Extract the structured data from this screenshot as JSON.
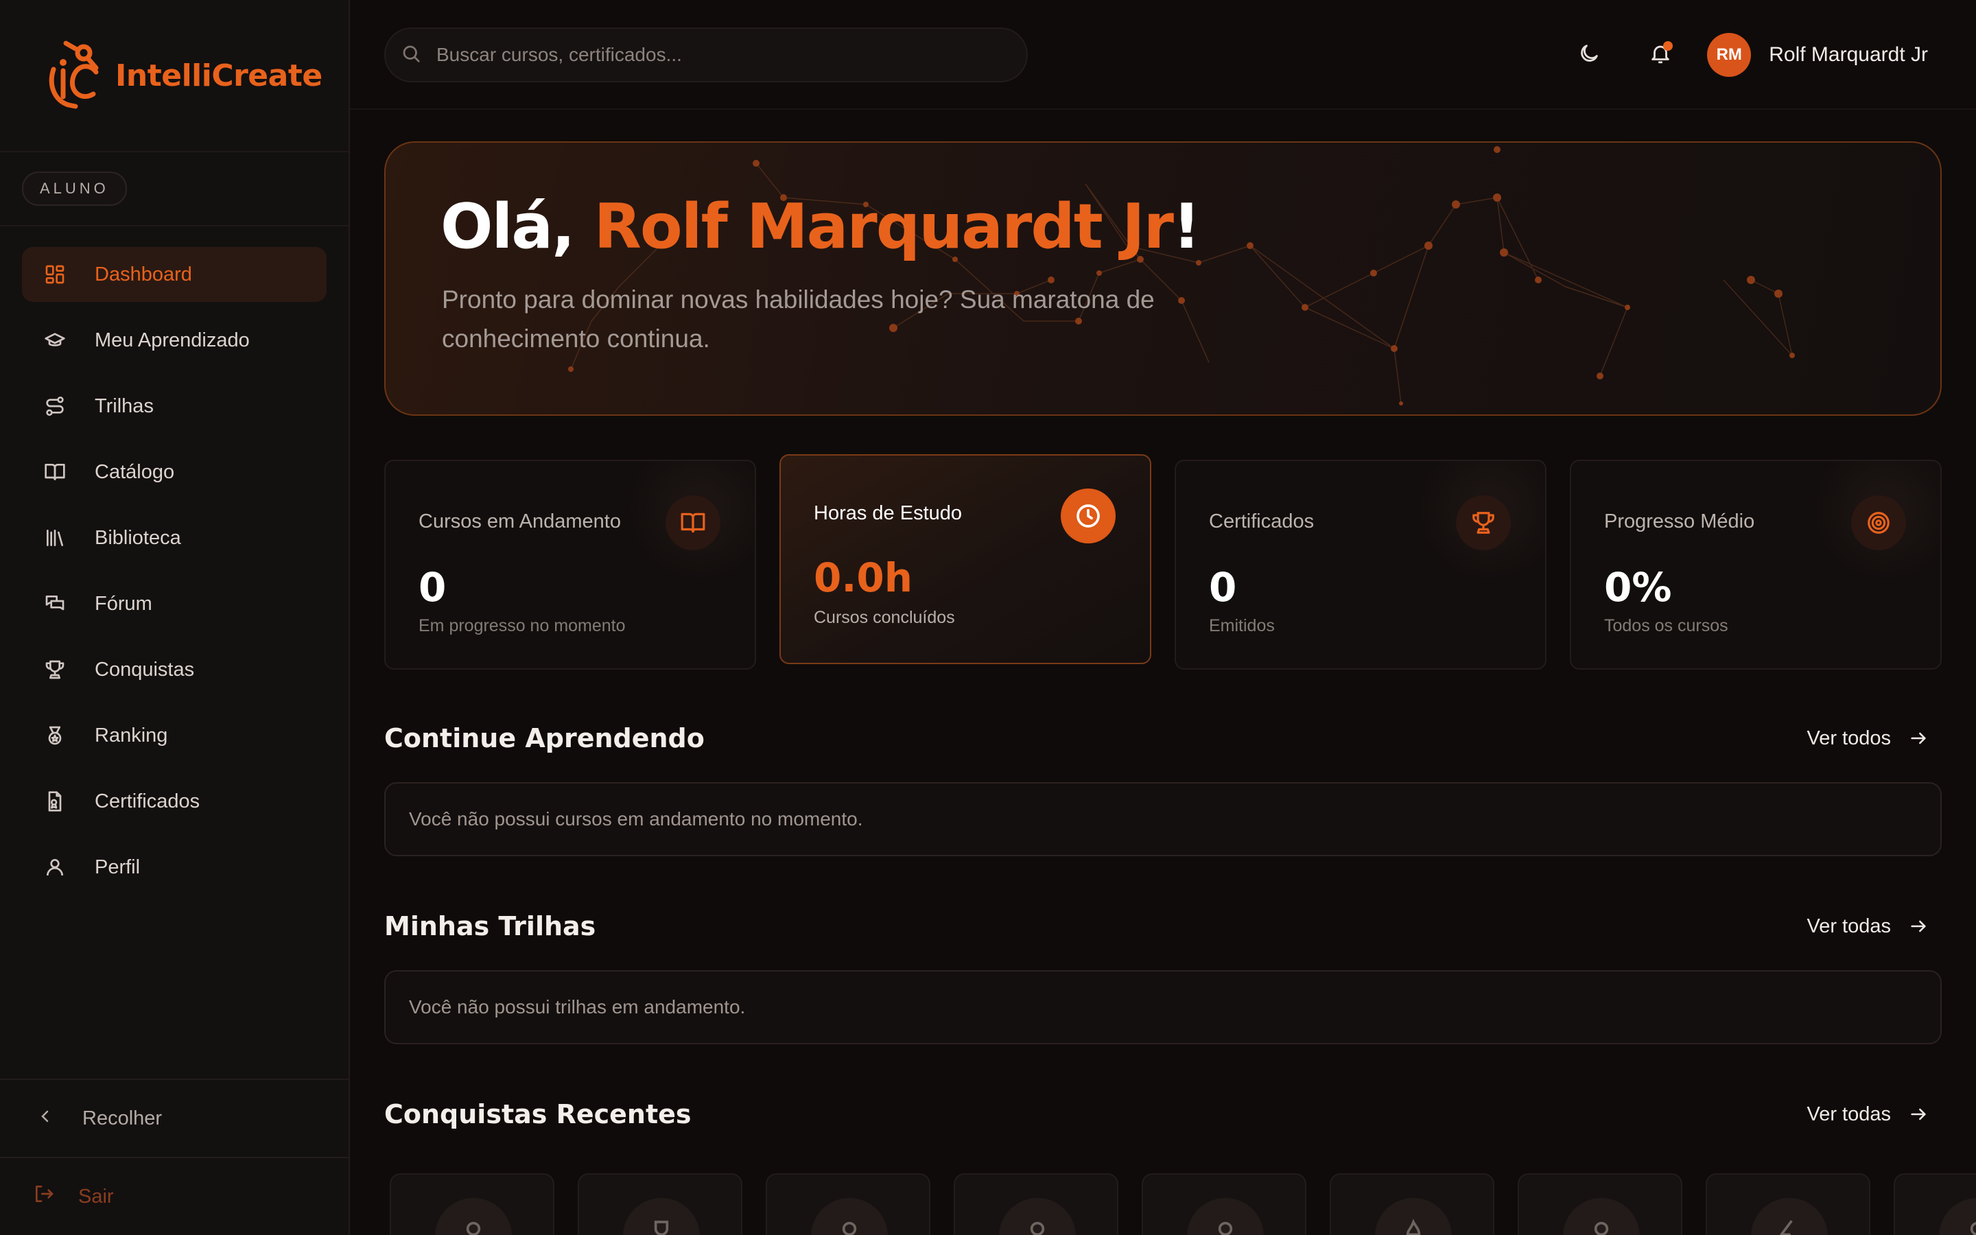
{
  "app": {
    "brand": "IntelliCreate",
    "role_badge": "ALUNO"
  },
  "colors": {
    "accent": "#e8621c",
    "background": "#0f0b0a",
    "sidebar_bg": "#131010"
  },
  "sidebar": {
    "items": [
      {
        "label": "Dashboard",
        "icon": "dashboard-grid-icon",
        "active": true
      },
      {
        "label": "Meu Aprendizado",
        "icon": "graduation-cap-icon"
      },
      {
        "label": "Trilhas",
        "icon": "route-icon"
      },
      {
        "label": "Catálogo",
        "icon": "book-open-icon"
      },
      {
        "label": "Biblioteca",
        "icon": "library-icon"
      },
      {
        "label": "Fórum",
        "icon": "chat-bubbles-icon"
      },
      {
        "label": "Conquistas",
        "icon": "trophy-icon"
      },
      {
        "label": "Ranking",
        "icon": "medal-icon"
      },
      {
        "label": "Certificados",
        "icon": "certificate-icon"
      },
      {
        "label": "Perfil",
        "icon": "user-icon"
      }
    ],
    "collapse_label": "Recolher",
    "logout_label": "Sair"
  },
  "header": {
    "search_placeholder": "Buscar cursos, certificados...",
    "user_initials": "RM",
    "user_name": "Rolf Marquardt Jr"
  },
  "hero": {
    "greeting": "Olá, ",
    "name": "Rolf Marquardt Jr",
    "exclaim": "!",
    "subtitle": "Pronto para dominar novas habilidades hoje? Sua maratona de conhecimento continua."
  },
  "stats": [
    {
      "label": "Cursos em Andamento",
      "value": "0",
      "sub": "Em progresso no momento",
      "icon": "book-open-icon"
    },
    {
      "label": "Horas de Estudo",
      "value": "0.0h",
      "sub": "Cursos concluídos",
      "icon": "clock-icon",
      "featured": true
    },
    {
      "label": "Certificados",
      "value": "0",
      "sub": "Emitidos",
      "icon": "trophy-icon"
    },
    {
      "label": "Progresso Médio",
      "value": "0%",
      "sub": "Todos os cursos",
      "icon": "target-icon"
    }
  ],
  "sections": {
    "continue": {
      "title": "Continue Aprendendo",
      "link": "Ver todos",
      "empty": "Você não possui cursos em andamento no momento."
    },
    "tracks": {
      "title": "Minhas Trilhas",
      "link": "Ver todas",
      "empty": "Você não possui trilhas em andamento."
    },
    "achievements": {
      "title": "Conquistas Recentes",
      "link": "Ver todas"
    }
  },
  "achievement_badges": [
    {
      "icon": "lock-icon"
    },
    {
      "icon": "trophy-icon"
    },
    {
      "icon": "lock-icon"
    },
    {
      "icon": "lock-icon"
    },
    {
      "icon": "lock-icon"
    },
    {
      "icon": "flame-icon"
    },
    {
      "icon": "lock-icon"
    },
    {
      "icon": "zap-icon"
    },
    {
      "icon": "lock-icon"
    }
  ]
}
